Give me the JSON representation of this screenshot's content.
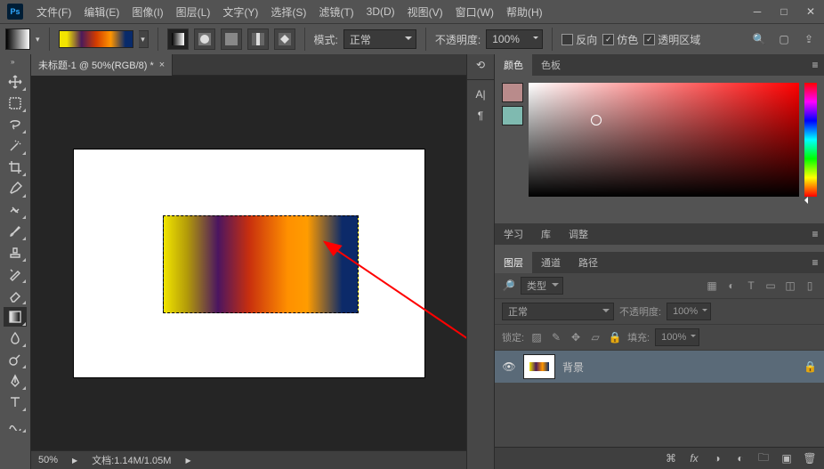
{
  "app": {
    "logo": "Ps"
  },
  "menu": [
    "文件(F)",
    "编辑(E)",
    "图像(I)",
    "图层(L)",
    "文字(Y)",
    "选择(S)",
    "滤镜(T)",
    "3D(D)",
    "视图(V)",
    "窗口(W)",
    "帮助(H)"
  ],
  "opt": {
    "mode_label": "模式:",
    "mode_value": "正常",
    "opacity_label": "不透明度:",
    "opacity_value": "100%",
    "reverse": "反向",
    "dither": "仿色",
    "transparency": "透明区域"
  },
  "doc": {
    "tab": "未标题-1 @ 50%(RGB/8) *"
  },
  "status": {
    "zoom": "50%",
    "docinfo": "文档:1.14M/1.05M"
  },
  "color_panel": {
    "tabs": [
      "颜色",
      "色板"
    ],
    "fg": "#b98b8b",
    "bg": "#7fbab0"
  },
  "mid_tabs": [
    "学习",
    "库",
    "调整"
  ],
  "layers": {
    "tabs": [
      "图层",
      "通道",
      "路径"
    ],
    "kind_label": "类型",
    "blend": "正常",
    "opacity_label": "不透明度:",
    "opacity_value": "100%",
    "lock_label": "锁定:",
    "fill_label": "填充:",
    "fill_value": "100%",
    "items": [
      {
        "name": "背景"
      }
    ]
  }
}
